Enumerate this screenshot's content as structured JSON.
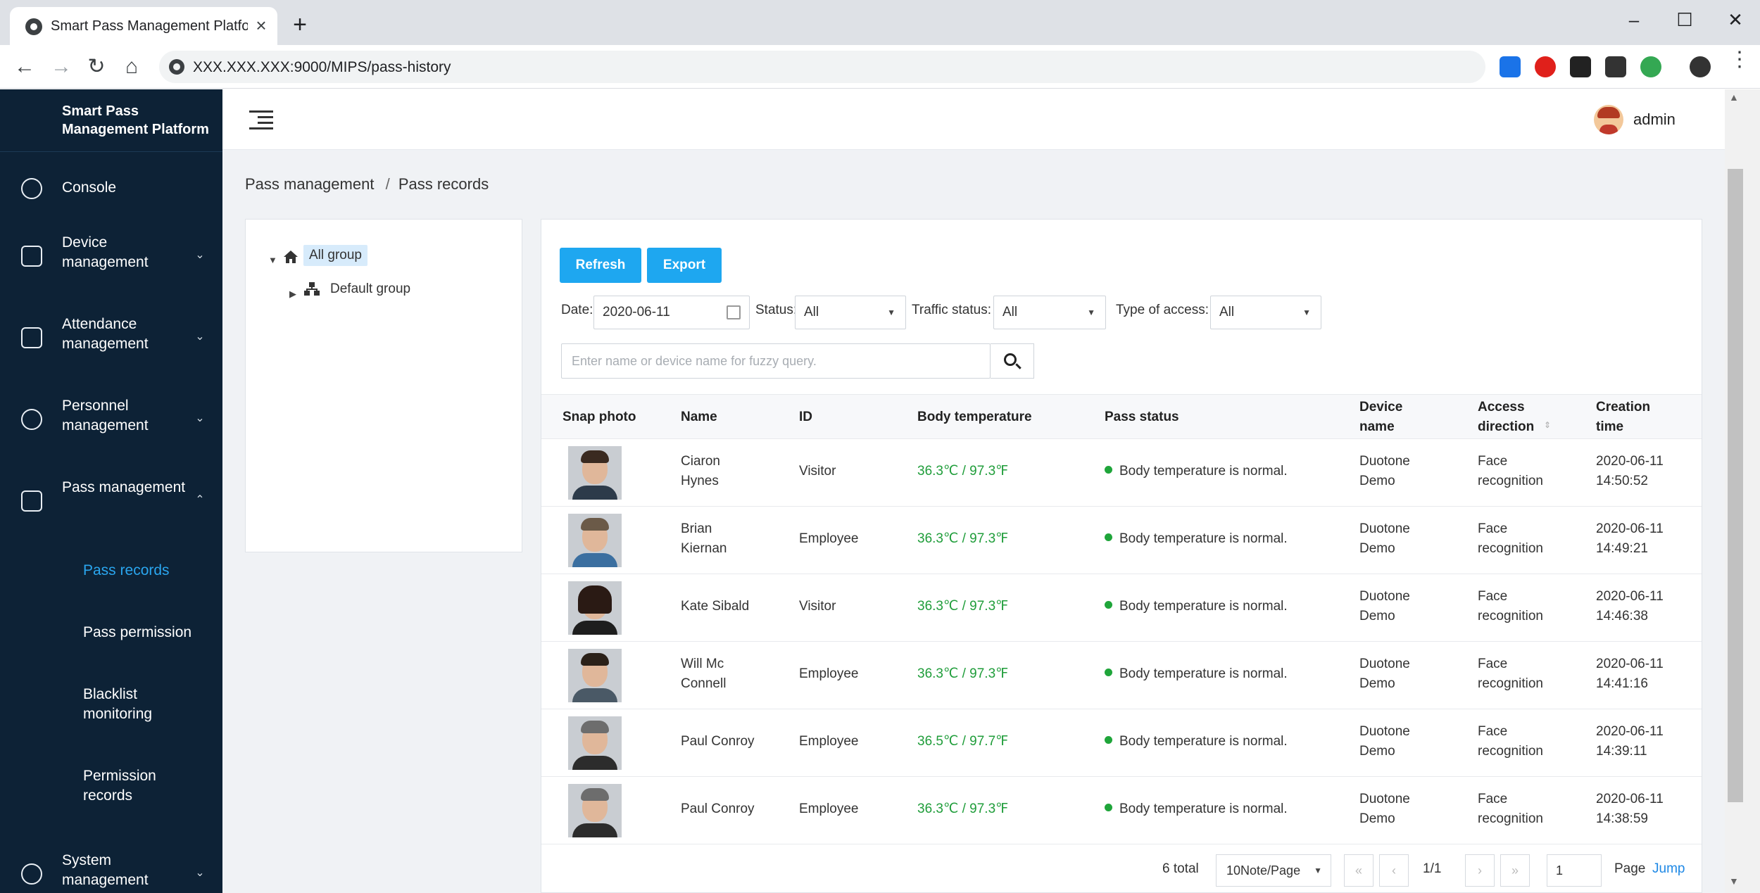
{
  "browser": {
    "tab_title": "Smart Pass Management Platform",
    "url": "XXX.XXX.XXX:9000/MIPS/pass-history"
  },
  "sidebar": {
    "brand": "Smart Pass Management Platform",
    "items": [
      {
        "label": "Console",
        "icon": "dashboard-icon"
      },
      {
        "label": "Device management",
        "icon": "devices-icon"
      },
      {
        "label": "Attendance management",
        "icon": "calendar-icon"
      },
      {
        "label": "Personnel management",
        "icon": "people-icon"
      },
      {
        "label": "Pass management",
        "icon": "pass-icon"
      },
      {
        "label": "System management",
        "icon": "gear-icon"
      }
    ],
    "sub_items": [
      {
        "label": "Pass records",
        "active": true
      },
      {
        "label": "Pass permission"
      },
      {
        "label": "Blacklist monitoring"
      },
      {
        "label": "Permission records"
      }
    ]
  },
  "header": {
    "user": "admin"
  },
  "breadcrumb": {
    "parent": "Pass management",
    "separator": "/",
    "current": "Pass records"
  },
  "tree": {
    "root": "All group",
    "child": "Default group"
  },
  "toolbar": {
    "refresh": "Refresh",
    "export": "Export"
  },
  "filters": {
    "date_label": "Date:",
    "date_value": "2020-06-11",
    "status_label": "Status:",
    "status_value": "All",
    "traffic_label": "Traffic status:",
    "traffic_value": "All",
    "access_label": "Type of access:",
    "access_value": "All",
    "search_placeholder": "Enter name or device name for fuzzy query."
  },
  "table": {
    "headers": [
      "Snap photo",
      "Name",
      "ID",
      "Body temperature",
      "Pass status",
      "Device name",
      "Access direction",
      "Creation time"
    ],
    "rows": [
      {
        "name": "Ciaron Hynes",
        "id": "Visitor",
        "temp": "36.3℃ / 97.3℉",
        "status": "Body temperature is normal.",
        "device": "Duotone Demo",
        "direction": "Face recognition",
        "time": "2020-06-11 14:50:52"
      },
      {
        "name": "Brian Kiernan",
        "id": "Employee",
        "temp": "36.3℃ / 97.3℉",
        "status": "Body temperature is normal.",
        "device": "Duotone Demo",
        "direction": "Face recognition",
        "time": "2020-06-11 14:49:21"
      },
      {
        "name": "Kate Sibald",
        "id": "Visitor",
        "temp": "36.3℃ / 97.3℉",
        "status": "Body temperature is normal.",
        "device": "Duotone Demo",
        "direction": "Face recognition",
        "time": "2020-06-11 14:46:38"
      },
      {
        "name": "Will Mc Connell",
        "id": "Employee",
        "temp": "36.3℃ / 97.3℉",
        "status": "Body temperature is normal.",
        "device": "Duotone Demo",
        "direction": "Face recognition",
        "time": "2020-06-11 14:41:16"
      },
      {
        "name": "Paul Conroy",
        "id": "Employee",
        "temp": "36.5℃ / 97.7℉",
        "status": "Body temperature is normal.",
        "device": "Duotone Demo",
        "direction": "Face recognition",
        "time": "2020-06-11 14:39:11"
      },
      {
        "name": "Paul Conroy",
        "id": "Employee",
        "temp": "36.3℃ / 97.3℉",
        "status": "Body temperature is normal.",
        "device": "Duotone Demo",
        "direction": "Face recognition",
        "time": "2020-06-11 14:38:59"
      }
    ]
  },
  "pager": {
    "total": "6 total",
    "page_size": "10Note/Page",
    "page_info": "1/1",
    "goto_value": "1",
    "page_label": "Page",
    "jump": "Jump"
  },
  "colors": {
    "sidebar_bg": "#0d2236",
    "accent": "#1ea7f0",
    "temp_ok": "#1f9d3a"
  }
}
